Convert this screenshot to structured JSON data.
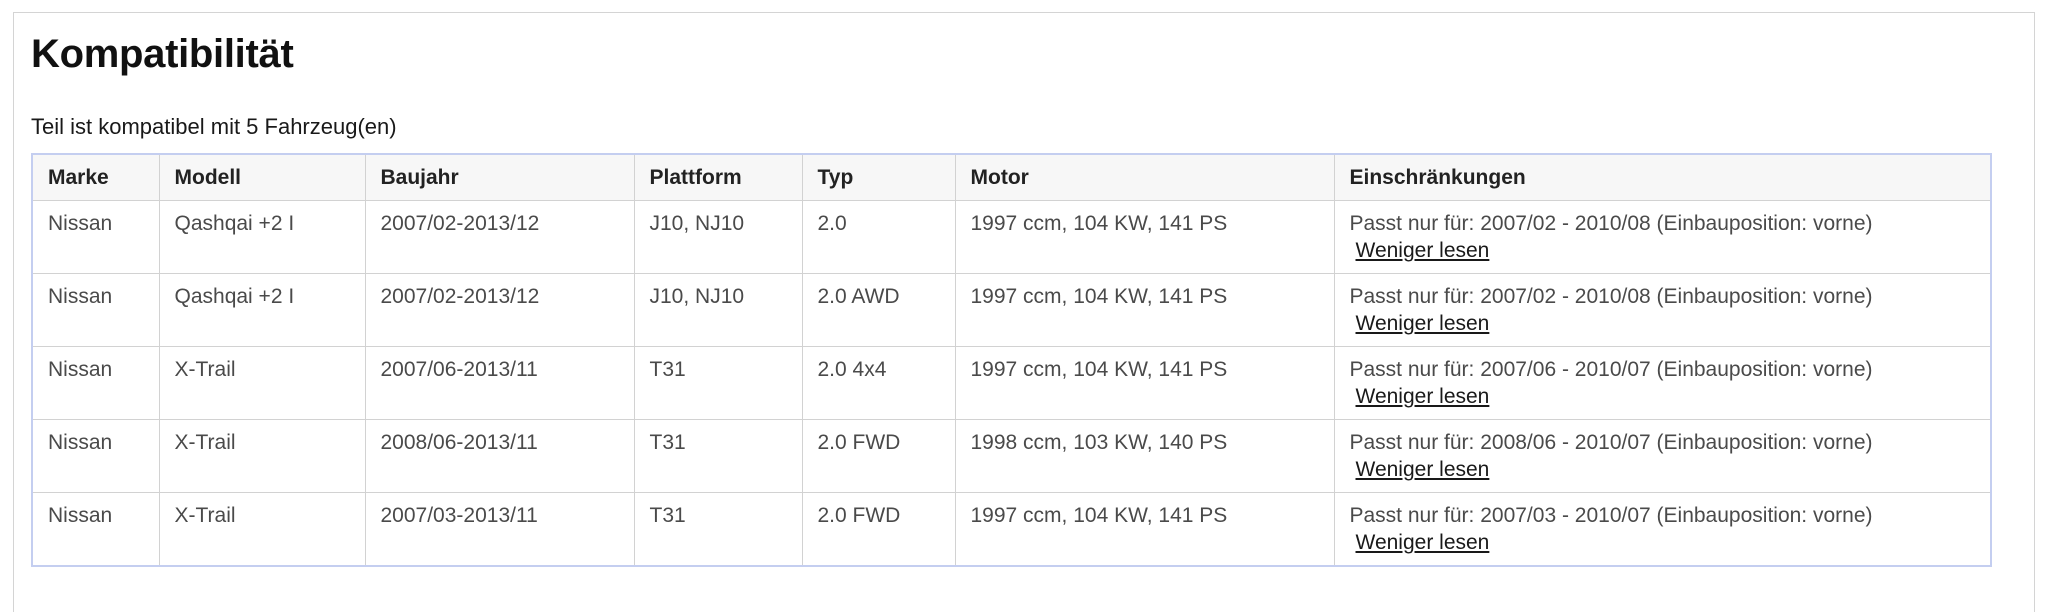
{
  "section": {
    "title": "Kompatibilität",
    "summary": "Teil ist kompatibel mit 5 Fahrzeug(en)"
  },
  "table": {
    "headers": [
      "Marke",
      "Modell",
      "Baujahr",
      "Plattform",
      "Typ",
      "Motor",
      "Einschränkungen"
    ],
    "rows": [
      {
        "marke": "Nissan",
        "modell": "Qashqai +2 I",
        "baujahr": "2007/02-2013/12",
        "plattform": "J10, NJ10",
        "typ": "2.0",
        "motor": "1997 ccm, 104 KW, 141 PS",
        "einschraenkungen": "Passt nur für: 2007/02 - 2010/08 (Einbauposition: vorne)",
        "link": "Weniger lesen"
      },
      {
        "marke": "Nissan",
        "modell": "Qashqai +2 I",
        "baujahr": "2007/02-2013/12",
        "plattform": "J10, NJ10",
        "typ": "2.0 AWD",
        "motor": "1997 ccm, 104 KW, 141 PS",
        "einschraenkungen": "Passt nur für: 2007/02 - 2010/08 (Einbauposition: vorne)",
        "link": "Weniger lesen"
      },
      {
        "marke": "Nissan",
        "modell": "X-Trail",
        "baujahr": "2007/06-2013/11",
        "plattform": "T31",
        "typ": "2.0 4x4",
        "motor": "1997 ccm, 104 KW, 141 PS",
        "einschraenkungen": "Passt nur für: 2007/06 - 2010/07 (Einbauposition: vorne)",
        "link": "Weniger lesen"
      },
      {
        "marke": "Nissan",
        "modell": "X-Trail",
        "baujahr": "2008/06-2013/11",
        "plattform": "T31",
        "typ": "2.0 FWD",
        "motor": "1998 ccm, 103 KW, 140 PS",
        "einschraenkungen": "Passt nur für: 2008/06 - 2010/07 (Einbauposition: vorne)",
        "link": "Weniger lesen"
      },
      {
        "marke": "Nissan",
        "modell": "X-Trail",
        "baujahr": "2007/03-2013/11",
        "plattform": "T31",
        "typ": "2.0 FWD",
        "motor": "1997 ccm, 104 KW, 141 PS",
        "einschraenkungen": "Passt nur für: 2007/03 - 2010/07 (Einbauposition: vorne)",
        "link": "Weniger lesen"
      }
    ]
  }
}
